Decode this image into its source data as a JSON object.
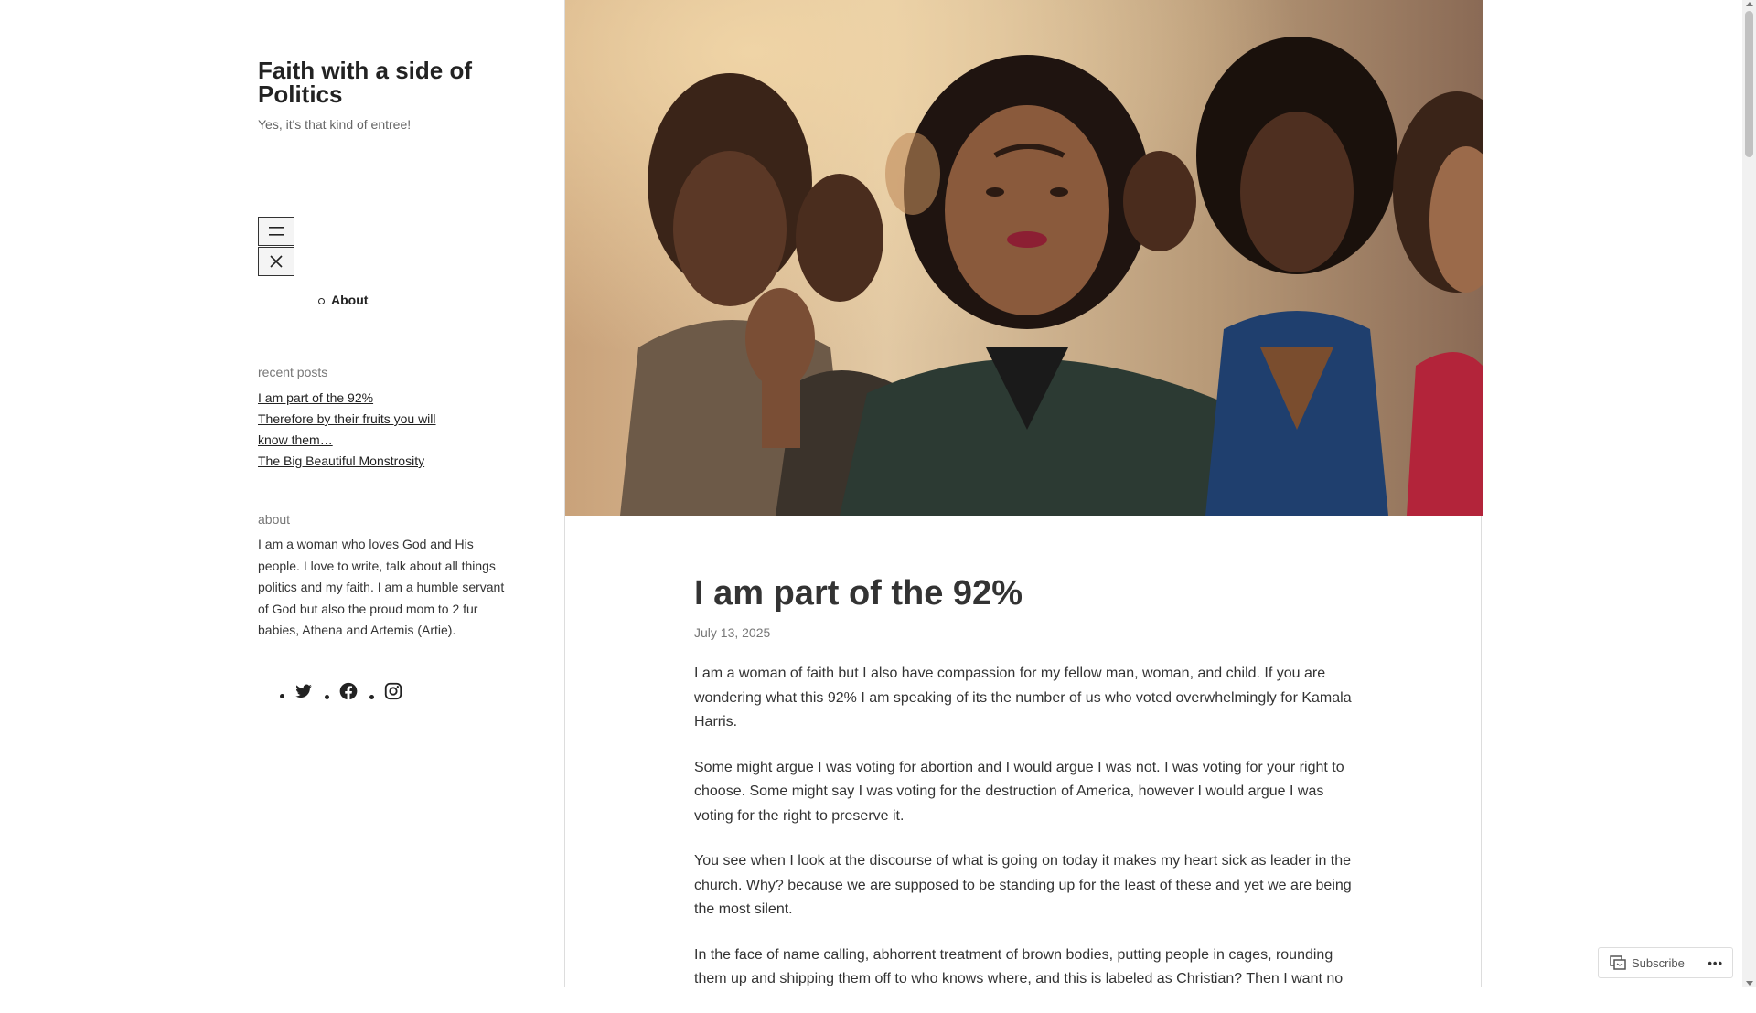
{
  "site": {
    "title": "Faith with a side of Politics",
    "description": "Yes, it's that kind of entree!"
  },
  "nav": {
    "items": [
      {
        "label": "About"
      }
    ]
  },
  "widgets": {
    "recent_title": "recent posts",
    "recent_posts": [
      "I am part of the 92%",
      "Therefore by their fruits you will know them…",
      "The Big Beautiful Monstrosity"
    ],
    "about_title": "about",
    "about_text": "I am a woman who loves God and His people. I love to write, talk about all things politics and my faith. I am a humble servant of God but also the proud mom to 2 fur babies, Athena and Artemis (Artie)."
  },
  "social": [
    "twitter-icon",
    "facebook-icon",
    "instagram-icon"
  ],
  "post": {
    "title": "I am part of the 92%",
    "date": "July 13, 2025",
    "paragraphs": [
      "I am a woman of faith but I also have compassion for my fellow man, woman, and child. If you are wondering what this 92% I am speaking of its the number of us who voted overwhelmingly for Kamala Harris.",
      "Some might argue I was voting for abortion and I would argue I was not. I was voting for your right to choose. Some might say I was voting for the destruction of America, however I would argue I was voting for the right to preserve it.",
      "You see when I look at the discourse of what is going on today it makes my heart sick as leader in the church. Why? because we are supposed to be standing up for the least of these and yet we are being the most silent.",
      "In the face of name calling, abhorrent treatment of brown bodies, putting people in cages, rounding them up and shipping them off to who knows where, and this is labeled as Christian? Then I want no"
    ]
  },
  "subscribe": {
    "label": "Subscribe",
    "more": "•••"
  }
}
